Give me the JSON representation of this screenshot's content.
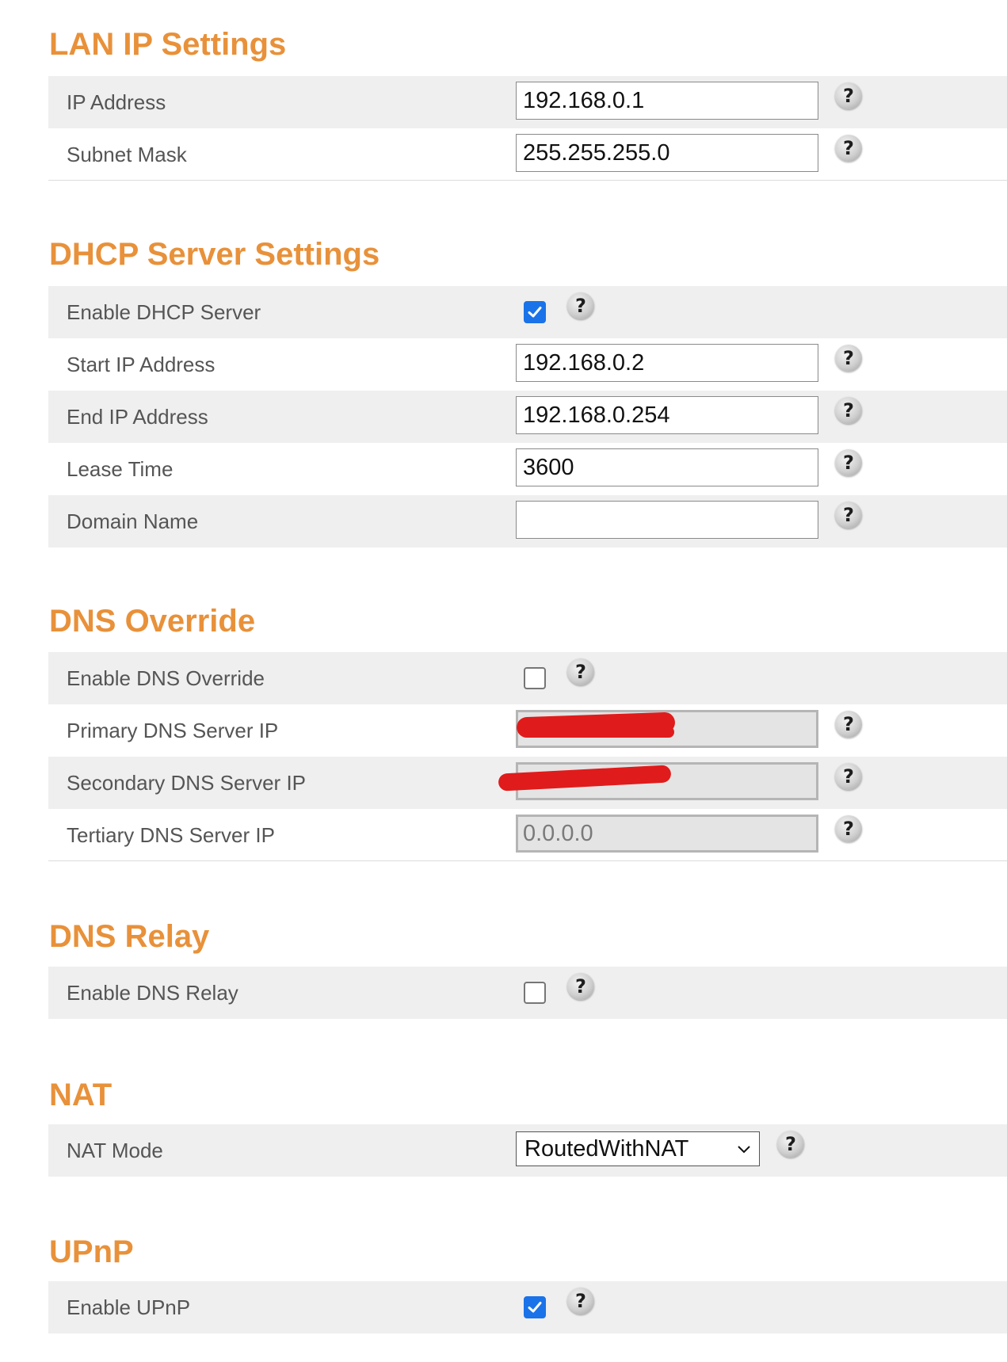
{
  "lan": {
    "title": "LAN IP Settings",
    "ip_label": "IP Address",
    "ip_value": "192.168.0.1",
    "subnet_label": "Subnet Mask",
    "subnet_value": "255.255.255.0"
  },
  "dhcp": {
    "title": "DHCP Server Settings",
    "enable_label": "Enable DHCP Server",
    "enabled": true,
    "start_label": "Start IP Address",
    "start_value": "192.168.0.2",
    "end_label": "End IP Address",
    "end_value": "192.168.0.254",
    "lease_label": "Lease Time",
    "lease_value": "3600",
    "domain_label": "Domain Name",
    "domain_value": ""
  },
  "dns_override": {
    "title": "DNS Override",
    "enable_label": "Enable DNS Override",
    "enabled": false,
    "primary_label": "Primary DNS Server IP",
    "secondary_label": "Secondary DNS Server IP",
    "tertiary_label": "Tertiary DNS Server IP",
    "tertiary_value": "0.0.0.0"
  },
  "dns_relay": {
    "title": "DNS Relay",
    "enable_label": "Enable DNS Relay",
    "enabled": false
  },
  "nat": {
    "title": "NAT",
    "mode_label": "NAT Mode",
    "mode_value": "RoutedWithNAT"
  },
  "upnp": {
    "title": "UPnP",
    "enable_label": "Enable UPnP",
    "enabled": true
  },
  "help_glyph": "?",
  "colors": {
    "section_title": "#e8913a",
    "row_shade": "#efefef",
    "checkbox_checked": "#1a73e8",
    "redaction": "#e01b1b"
  },
  "icons": {
    "help": "help-icon",
    "checkmark": "checkmark-icon",
    "dropdown": "chevron-down-icon"
  }
}
